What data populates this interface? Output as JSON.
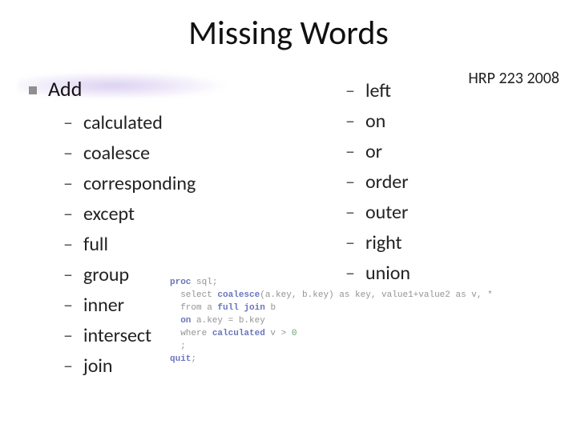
{
  "title": "Missing Words",
  "header_right": "HRP 223 2008",
  "bullet": {
    "label": "Add"
  },
  "columns": {
    "left": [
      "calculated",
      "coalesce",
      "corresponding",
      "except",
      "full",
      "group",
      "inner",
      "intersect",
      "join"
    ],
    "right": [
      "left",
      "on",
      "or",
      "order",
      "outer",
      "right",
      "union"
    ]
  },
  "code": {
    "l1a": "proc ",
    "l1b": "sql;",
    "l2a": "  select ",
    "l2b": "coalesce",
    "l2c": "(a.key, b.key) as key, value1+value2 as v, *",
    "l3a": "  from a ",
    "l3b": "full join",
    "l3c": " b",
    "l4a": "  ",
    "l4b": "on",
    "l4c": " a.key = b.key",
    "l5a": "  where ",
    "l5b": "calculated",
    "l5c": " v > ",
    "l5d": "0",
    "l6": "  ;",
    "l7a": "quit",
    "l7b": ";"
  }
}
